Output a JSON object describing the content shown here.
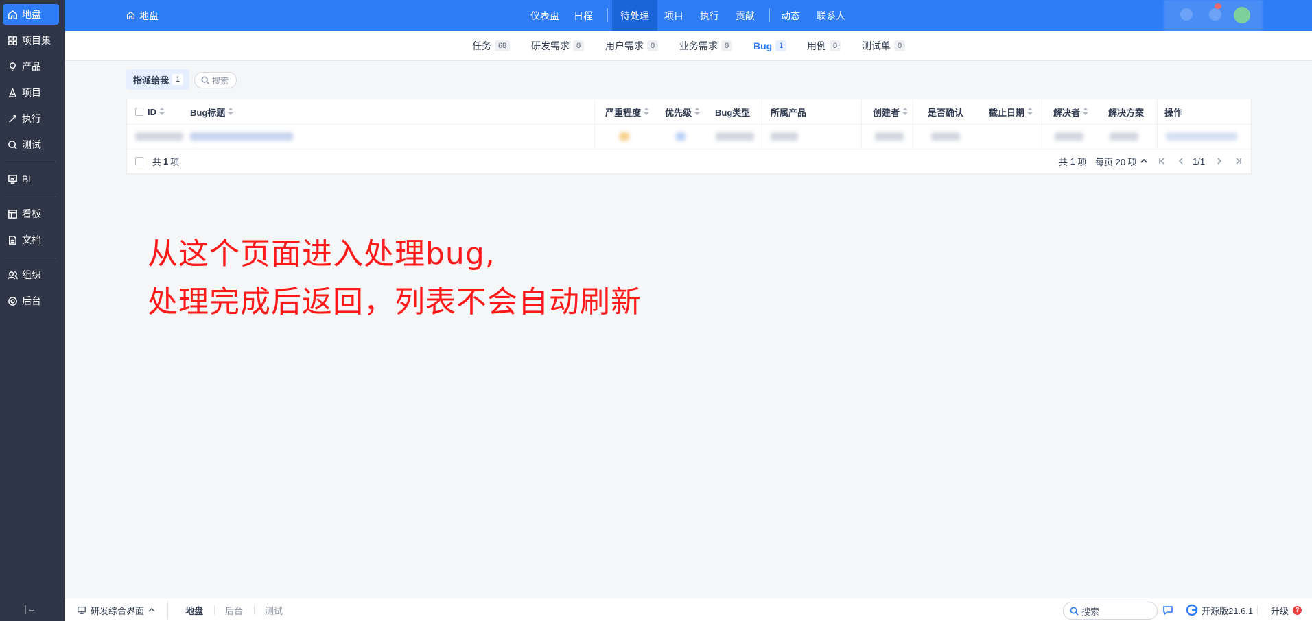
{
  "sidebar": {
    "items": [
      {
        "label": "地盘",
        "icon": "home-icon"
      },
      {
        "label": "项目集",
        "icon": "grid-icon"
      },
      {
        "label": "产品",
        "icon": "bulb-icon"
      },
      {
        "label": "项目",
        "icon": "project-icon"
      },
      {
        "label": "执行",
        "icon": "rocket-icon"
      },
      {
        "label": "测试",
        "icon": "test-icon"
      },
      {
        "label": "BI",
        "icon": "bi-icon"
      },
      {
        "label": "看板",
        "icon": "kanban-icon"
      },
      {
        "label": "文档",
        "icon": "document-icon"
      },
      {
        "label": "组织",
        "icon": "people-icon"
      },
      {
        "label": "后台",
        "icon": "gear-icon"
      }
    ]
  },
  "header": {
    "breadcrumb": "地盘",
    "nav": [
      "仪表盘",
      "日程",
      "待处理",
      "项目",
      "执行",
      "贡献",
      "动态",
      "联系人"
    ]
  },
  "subtabs": [
    {
      "label": "任务",
      "count": "68"
    },
    {
      "label": "研发需求",
      "count": "0"
    },
    {
      "label": "用户需求",
      "count": "0"
    },
    {
      "label": "业务需求",
      "count": "0"
    },
    {
      "label": "Bug",
      "count": "1"
    },
    {
      "label": "用例",
      "count": "0"
    },
    {
      "label": "测试单",
      "count": "0"
    }
  ],
  "filter": {
    "label": "指派给我",
    "count": "1",
    "search": "搜索"
  },
  "table": {
    "columns": [
      "ID",
      "Bug标题",
      "严重程度",
      "优先级",
      "Bug类型",
      "所属产品",
      "创建者",
      "是否确认",
      "截止日期",
      "解决者",
      "解决方案",
      "操作"
    ],
    "footer_left": {
      "prefix": "共",
      "count": "1",
      "suffix": "项"
    },
    "footer_right": {
      "prefix": "共",
      "count": "1",
      "suffix": "项",
      "per_page": "每页 20 项",
      "page": "1/1"
    }
  },
  "annotation": {
    "line1": "从这个页面进入处理bug,",
    "line2": "处理完成后返回，列表不会自动刷新"
  },
  "bottombar": {
    "workspace": "研发综合界面",
    "breadcrumbs": [
      "地盘",
      "后台",
      "测试"
    ],
    "search": "搜索",
    "version": "开源版21.6.1",
    "upgrade": "升级"
  },
  "colors": {
    "primary": "#2e7cf6",
    "sidebar": "#2f3648",
    "annotation": "#ff1a1a"
  }
}
